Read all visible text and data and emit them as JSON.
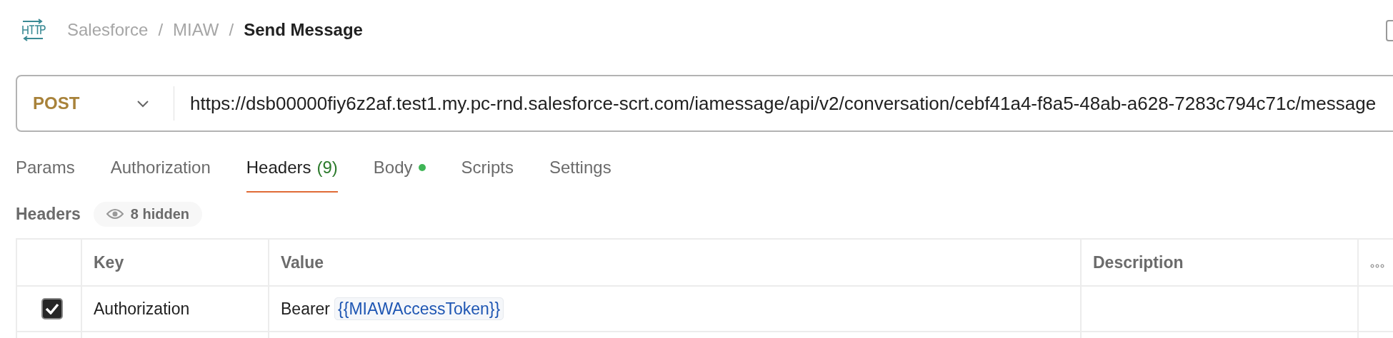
{
  "breadcrumb": {
    "items": [
      "Salesforce",
      "MIAW"
    ],
    "separator": "/",
    "current": "Send Message"
  },
  "request": {
    "method": "POST",
    "url": "https://dsb00000fiy6z2af.test1.my.pc-rnd.salesforce-scrt.com/iamessage/api/v2/conversation/cebf41a4-f8a5-48ab-a628-7283c794c71c/message"
  },
  "tabs": [
    {
      "label": "Params",
      "selected": false
    },
    {
      "label": "Authorization",
      "selected": false
    },
    {
      "label": "Headers",
      "count": "(9)",
      "selected": true
    },
    {
      "label": "Body",
      "dot": true,
      "selected": false
    },
    {
      "label": "Scripts",
      "selected": false
    },
    {
      "label": "Settings",
      "selected": false
    }
  ],
  "headers": {
    "title": "Headers",
    "hidden_badge": "8 hidden",
    "columns": [
      "Key",
      "Value",
      "Description"
    ],
    "rows": [
      {
        "checked": true,
        "key": "Authorization",
        "value_text": "Bearer",
        "value_variable": "{{MIAWAccessToken}}"
      }
    ]
  }
}
